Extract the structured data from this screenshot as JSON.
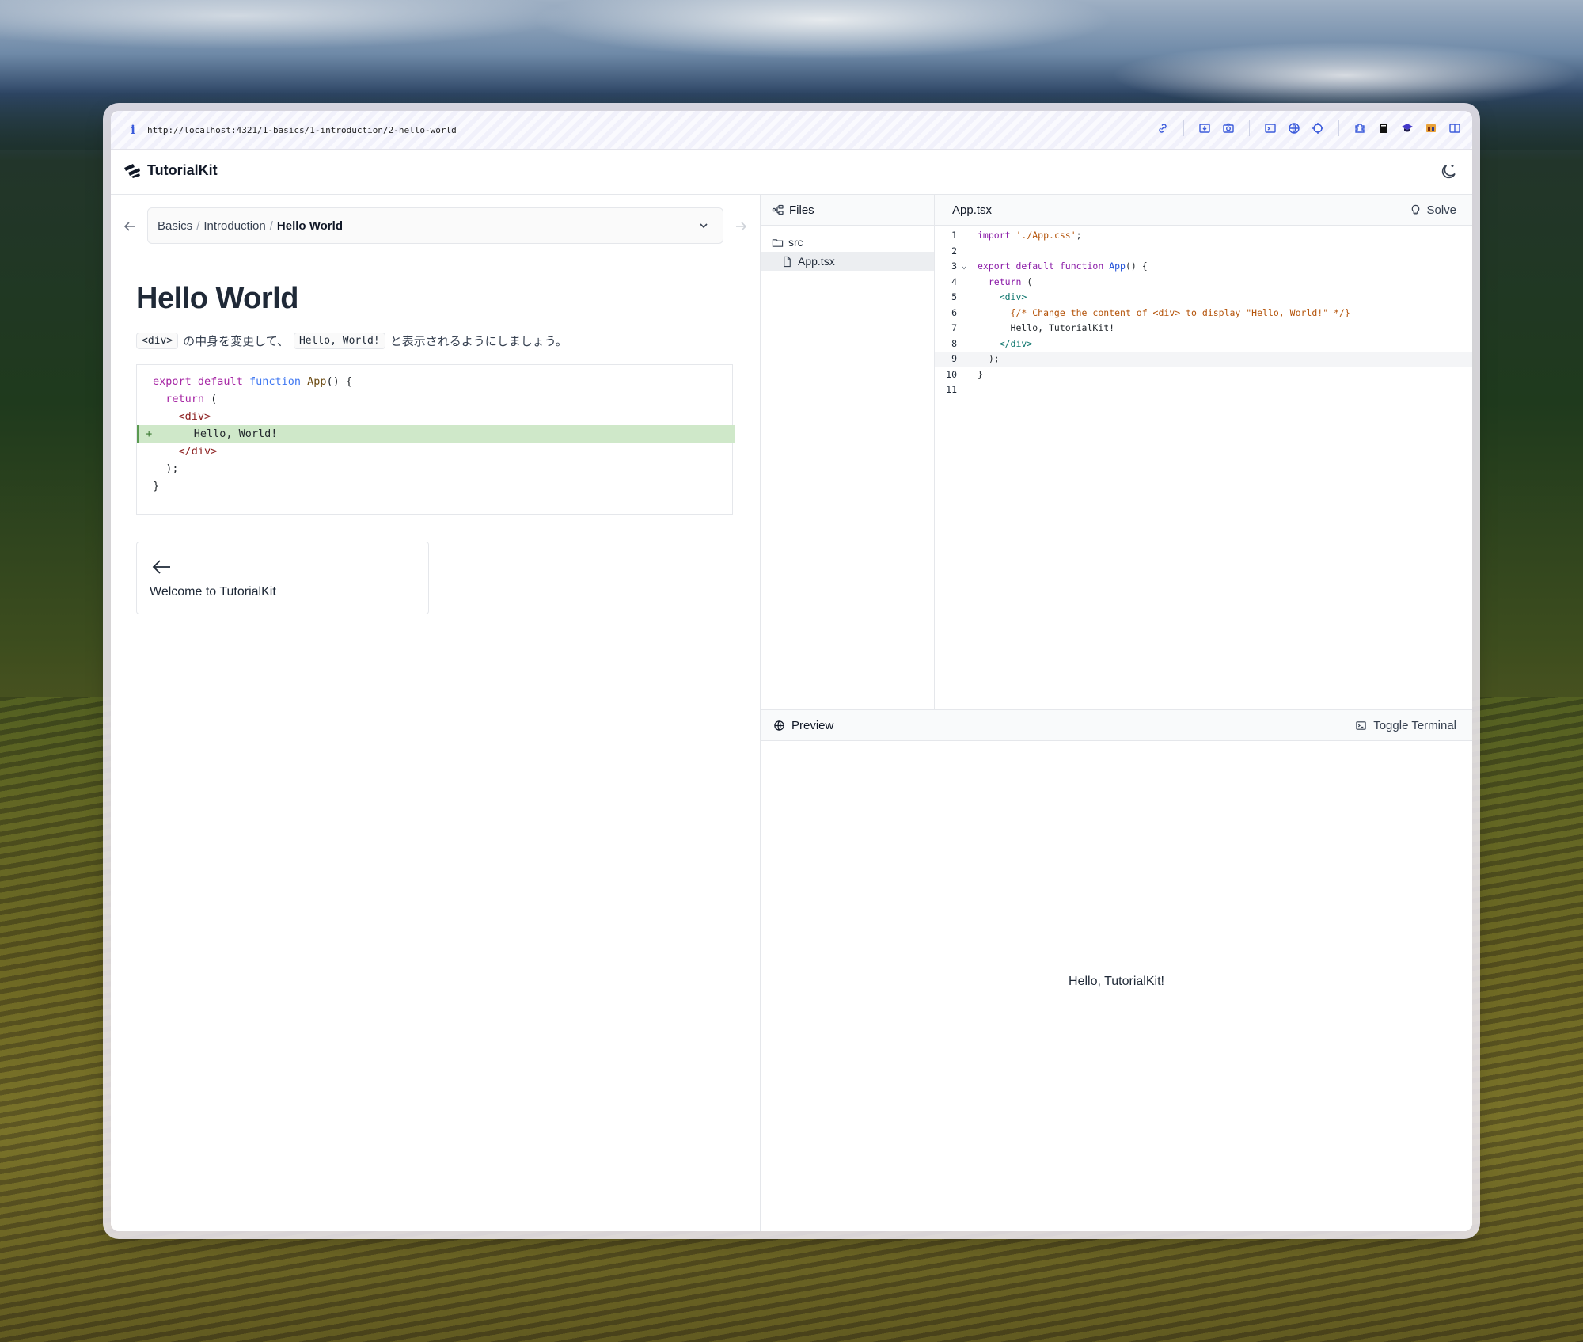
{
  "browser": {
    "info_icon": "info-icon",
    "url": "http://localhost:4321/1-basics/1-introduction/2-hello-world",
    "accent": "#3b5bdb"
  },
  "app": {
    "name": "TutorialKit"
  },
  "breadcrumb": {
    "items": [
      "Basics",
      "Introduction"
    ],
    "separator": "/",
    "current": "Hello World"
  },
  "lesson": {
    "title": "Hello World",
    "text": {
      "code1": "<div>",
      "part1": "の中身を変更して、",
      "code2": "Hello, World!",
      "part2": "と表示されるようにしましょう。"
    },
    "prev_card_label": "Welcome to TutorialKit"
  },
  "files": {
    "header": "Files",
    "tree": [
      {
        "type": "folder",
        "name": "src"
      },
      {
        "type": "file",
        "name": "App.tsx",
        "active": true
      }
    ]
  },
  "editor": {
    "tab": "App.tsx",
    "solve_label": "Solve",
    "line_numbers": [
      "1",
      "2",
      "3",
      "4",
      "5",
      "6",
      "7",
      "8",
      "9",
      "10",
      "11"
    ]
  },
  "preview": {
    "header": "Preview",
    "toggle_terminal": "Toggle Terminal",
    "output": "Hello, TutorialKit!"
  },
  "colors": {
    "added_line_bg": "#cfe8c9",
    "keyword": "#a626a4",
    "function": "#4078f2"
  }
}
